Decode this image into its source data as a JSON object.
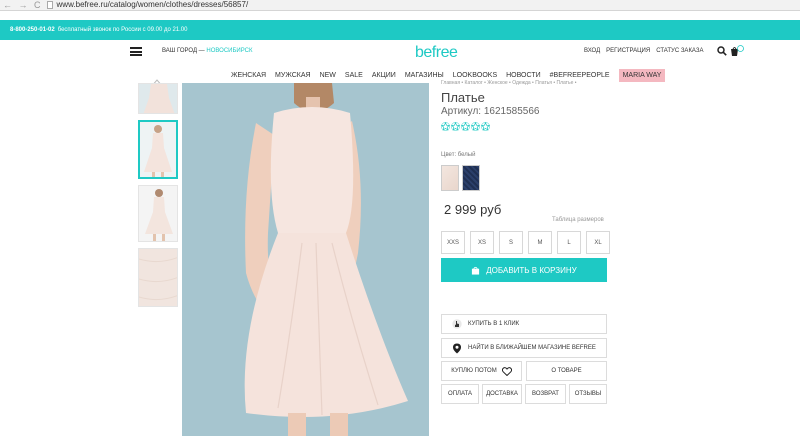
{
  "browser": {
    "url": "www.befree.ru/catalog/women/clothes/dresses/56857/",
    "nav": "← → C"
  },
  "topbar": {
    "phone": "8-800-250-01-02",
    "phone_note": "бесплатный звонок по России с 09.00 до 21.00"
  },
  "header": {
    "city_label": "ВАШ ГОРОД —",
    "city_name": "НОВОСИБИРСК",
    "logo": "befree",
    "login": "ВХОД",
    "register": "РЕГИСТРАЦИЯ",
    "order_status": "СТАТУС ЗАКАЗА"
  },
  "nav": {
    "items": [
      "ЖЕНСКАЯ",
      "МУЖСКАЯ",
      "NEW",
      "SALE",
      "АКЦИИ",
      "МАГАЗИНЫ",
      "LOOKBOOKS",
      "НОВОСТИ",
      "#BEFREEPEOPLE"
    ],
    "highlight": "MARIA WAY"
  },
  "product": {
    "breadcrumb": "Главная • Каталог • Женское • Одежда • Платья • Платье •",
    "title": "Платье",
    "article": "Артикул: 1621585566",
    "rating_filled": 0,
    "rating_max": 5,
    "color_label": "Цвет: белый",
    "price": "2 999 руб",
    "size_table": "Таблица размеров",
    "sizes": [
      "XXS",
      "XS",
      "S",
      "M",
      "L",
      "XL"
    ],
    "add_to_cart": "ДОБАВИТЬ В КОРЗИНУ",
    "buy_one_click": "КУПИТЬ В 1 КЛИК",
    "find_store": "НАЙТИ В БЛИЖАЙШЕМ МАГАЗИНЕ BEFREE",
    "buy_later": "КУПЛЮ ПОТОМ",
    "about": "О ТОВАРЕ",
    "tabs": [
      "ОПЛАТА",
      "ДОСТАВКА",
      "ВОЗВРАТ",
      "ОТЗЫВЫ"
    ]
  },
  "colors": {
    "accent": "#1ec9c4",
    "highlight": "#f4b8c0",
    "image_bg": "#a6c5cf"
  }
}
